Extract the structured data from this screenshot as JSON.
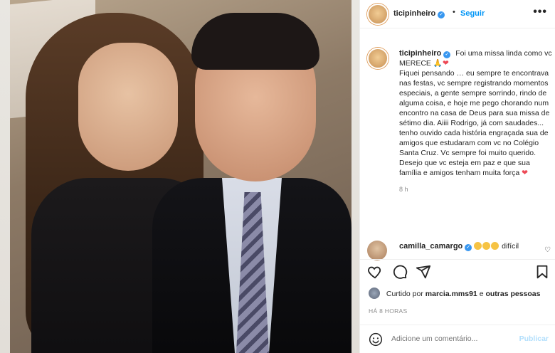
{
  "post": {
    "author": "ticipinheiro",
    "follow_label": "Seguir",
    "more_label": "•••"
  },
  "caption": {
    "username": "ticipinheiro",
    "line1": "Foi uma missa linda como vc MERECE",
    "body": "Fiquei pensando … eu sempre te encontrava nas festas, vc sempre registrando momentos especiais, a gente sempre sorrindo, rindo de alguma coisa, e hoje me pego chorando num encontro na casa de Deus para sua missa de sétimo dia. Aiiii Rodrigo, já com saudades... tenho ouvido cada história engraçada sua de amigos que estudaram com vc no Colégio Santa Cruz. Vc sempre foi muito querido. Desejo que vc esteja em paz e que sua família e amigos tenham muita força",
    "time": "8 h"
  },
  "comment": {
    "username": "camilla_camargo",
    "text": "difícil"
  },
  "likes": {
    "prefix": "Curtido por",
    "user": "marcia.mms91",
    "suffix": "e",
    "others": "outras pessoas"
  },
  "timestamp": "HÁ 8 HORAS",
  "add_comment": {
    "placeholder": "Adicione um comentário...",
    "post_label": "Publicar"
  },
  "icons": {
    "like": "heart-icon",
    "comment": "comment-icon",
    "share": "share-icon",
    "save": "bookmark-icon",
    "emoji": "smile-icon",
    "verified": "verified-badge-icon"
  },
  "colors": {
    "link": "#0095f6",
    "verified": "#3897f0",
    "muted": "#8e8e8e",
    "heart": "#ed4956"
  }
}
